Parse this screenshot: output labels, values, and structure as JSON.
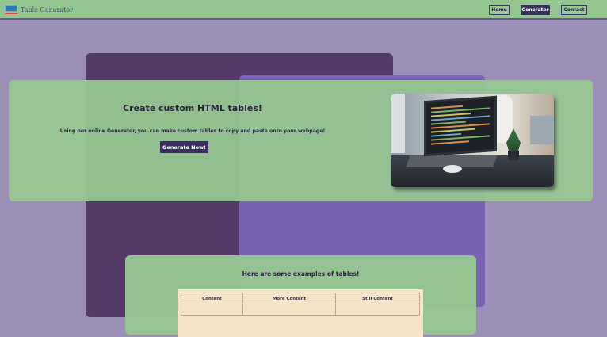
{
  "header": {
    "brand": "Table Generator",
    "nav": [
      {
        "label": "Home",
        "active": false
      },
      {
        "label": "Generator",
        "active": true
      },
      {
        "label": "Contact",
        "active": false
      }
    ]
  },
  "hero": {
    "title": "Create custom HTML tables!",
    "description": "Using our online Generator, you can make custom tables to copy and paste onto your webpage!",
    "button_label": "Generate Now!"
  },
  "examples": {
    "title": "Here are some examples of tables!",
    "table": {
      "headers": [
        "Content",
        "More Content",
        "Still Content"
      ],
      "rows": [
        [
          "",
          "",
          ""
        ]
      ]
    }
  },
  "colors": {
    "page_background": "#9b8fb7",
    "header_green": "#93c58f",
    "accent_purple": "#3a2f63",
    "table_background": "#f4e4c8"
  }
}
